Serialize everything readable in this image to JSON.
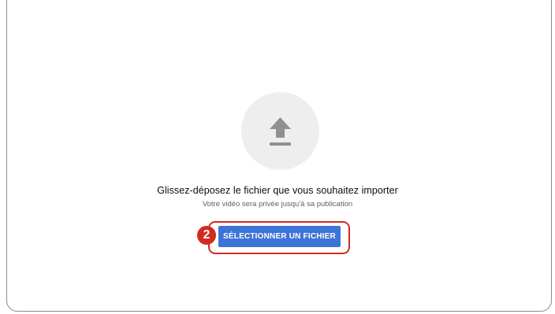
{
  "upload": {
    "icon": "upload-arrow-icon",
    "title": "Glissez-déposez le fichier que vous souhaitez importer",
    "subtitle": "Votre vidéo sera privée jusqu'à sa publication",
    "select_button_label": "SÉLECTIONNER UN FICHIER"
  },
  "annotation": {
    "step_number": "2",
    "color": "#d12b1f"
  },
  "colors": {
    "button": "#3e74d6",
    "circle": "#eeeeee",
    "icon": "#909090"
  }
}
